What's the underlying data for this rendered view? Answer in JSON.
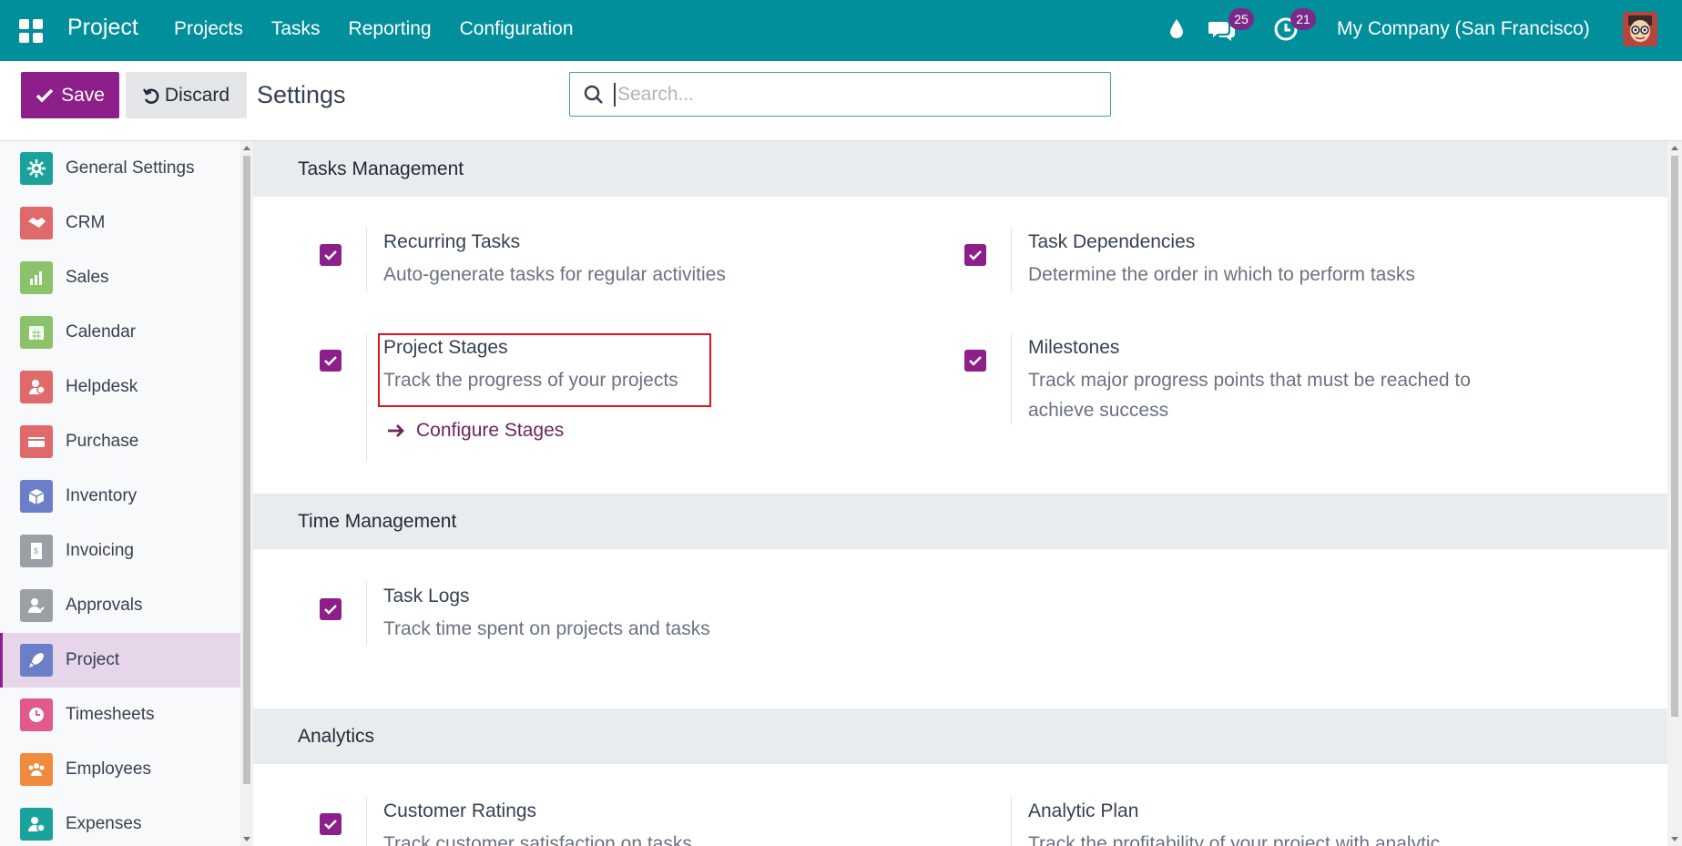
{
  "navbar": {
    "brand": "Project",
    "menu": [
      "Projects",
      "Tasks",
      "Reporting",
      "Configuration"
    ],
    "messages_count": "25",
    "activities_count": "21",
    "company": "My Company (San Francisco)"
  },
  "control": {
    "save_label": "Save",
    "discard_label": "Discard",
    "title": "Settings",
    "search_placeholder": "Search..."
  },
  "sidebar": {
    "items": [
      {
        "label": "General Settings",
        "icon": "gear-icon",
        "color": "#1aa39a"
      },
      {
        "label": "CRM",
        "icon": "handshake-icon",
        "color": "#e06a6a"
      },
      {
        "label": "Sales",
        "icon": "chart-icon",
        "color": "#8bc26a"
      },
      {
        "label": "Calendar",
        "icon": "calendar-icon",
        "color": "#8bc26a"
      },
      {
        "label": "Helpdesk",
        "icon": "helpdesk-icon",
        "color": "#e06a6a"
      },
      {
        "label": "Purchase",
        "icon": "card-icon",
        "color": "#e06a6a"
      },
      {
        "label": "Inventory",
        "icon": "box-icon",
        "color": "#6b7fc9"
      },
      {
        "label": "Invoicing",
        "icon": "invoice-icon",
        "color": "#9aa0a6"
      },
      {
        "label": "Approvals",
        "icon": "approval-icon",
        "color": "#9aa0a6"
      },
      {
        "label": "Project",
        "icon": "rocket-icon",
        "color": "#6b7fc9",
        "active": true
      },
      {
        "label": "Timesheets",
        "icon": "timesheet-icon",
        "color": "#e25a8a"
      },
      {
        "label": "Employees",
        "icon": "people-icon",
        "color": "#f08a3c"
      },
      {
        "label": "Expenses",
        "icon": "expense-icon",
        "color": "#1aa39a"
      }
    ]
  },
  "sections": {
    "tasks": {
      "title": "Tasks Management",
      "recurring": {
        "title": "Recurring Tasks",
        "desc": "Auto-generate tasks for regular activities",
        "checked": true
      },
      "dependencies": {
        "title": "Task Dependencies",
        "desc": "Determine the order in which to perform tasks",
        "checked": true
      },
      "stages": {
        "title": "Project Stages",
        "desc": "Track the progress of your projects",
        "checked": true,
        "link": "Configure Stages"
      },
      "milestones": {
        "title": "Milestones",
        "desc": "Track major progress points that must be reached to achieve success",
        "checked": true
      }
    },
    "time": {
      "title": "Time Management",
      "logs": {
        "title": "Task Logs",
        "desc": "Track time spent on projects and tasks",
        "checked": true
      }
    },
    "analytics": {
      "title": "Analytics",
      "ratings": {
        "title": "Customer Ratings",
        "desc": "Track customer satisfaction on tasks",
        "checked": true
      },
      "plan": {
        "title": "Analytic Plan",
        "desc": "Track the profitability of your project with analytic"
      }
    }
  },
  "colors": {
    "navbar": "#018f9c",
    "primary": "#8c1f8a",
    "highlight_box": "#e0131c"
  }
}
